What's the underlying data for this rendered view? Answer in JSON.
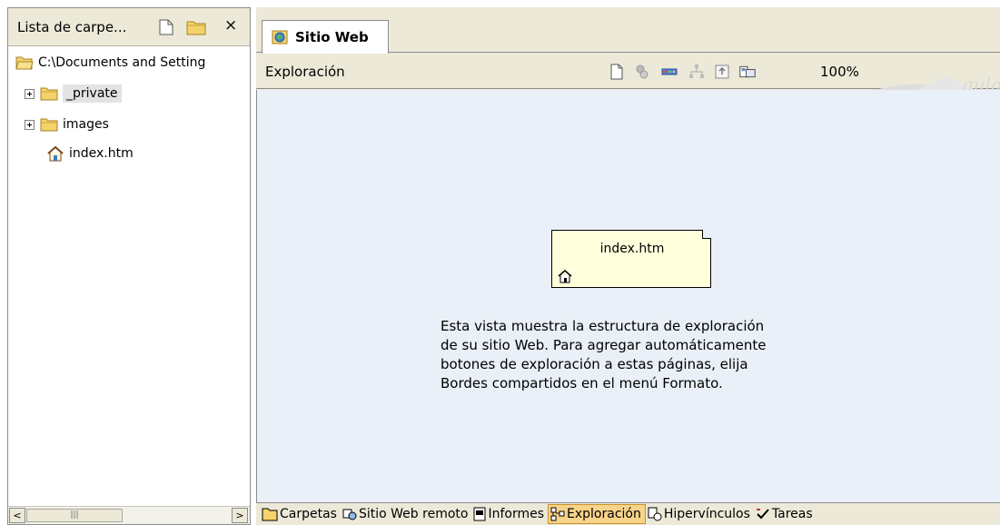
{
  "folder_list": {
    "title": "Lista de carpe...",
    "close_glyph": "×",
    "root_path": "C:\\Documents and Setting",
    "items": [
      {
        "label": "_private",
        "type": "folder",
        "expandable": true,
        "selected": true
      },
      {
        "label": "images",
        "type": "folder",
        "expandable": true,
        "selected": false
      },
      {
        "label": "index.htm",
        "type": "home-page",
        "expandable": false,
        "selected": false
      }
    ]
  },
  "main": {
    "tab_label": "Sitio Web",
    "view_title": "Exploración",
    "zoom_level": "100%",
    "node_label": "index.htm",
    "info_lines": [
      "Esta vista muestra la estructura de exploración",
      "de su sitio Web. Para agregar automáticamente",
      "botones de exploración a estas páginas, elija",
      "Bordes compartidos en el menú Formato."
    ]
  },
  "view_bar": {
    "items": [
      {
        "label": "Carpetas",
        "icon": "folder-icon",
        "active": false
      },
      {
        "label": "Sitio Web remoto",
        "icon": "remote-site-icon",
        "active": false
      },
      {
        "label": "Informes",
        "icon": "reports-icon",
        "active": false
      },
      {
        "label": "Exploración",
        "icon": "navigation-icon",
        "active": true
      },
      {
        "label": "Hipervínculos",
        "icon": "hyperlinks-icon",
        "active": false
      },
      {
        "label": "Tareas",
        "icon": "tasks-icon",
        "active": false
      }
    ]
  },
  "colors": {
    "folder": "#f3d36a",
    "canvas": "#eaf0f7",
    "node_fill": "#ffffdc",
    "active_view": "#f8d48a",
    "chrome": "#ece9d8"
  }
}
